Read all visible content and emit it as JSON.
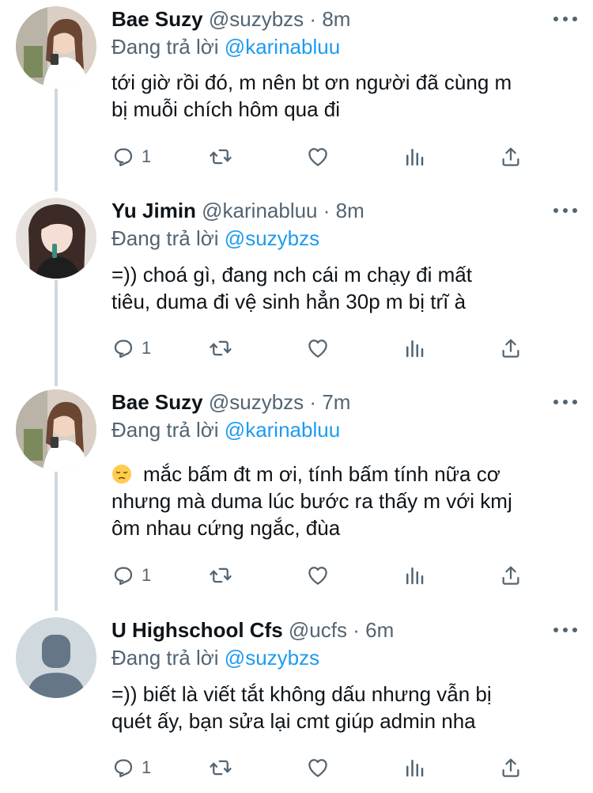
{
  "tweets": [
    {
      "name": "Bae Suzy",
      "handle": "@suzybzs",
      "dot": "·",
      "time": "8m",
      "reply_prefix": "Đang trả lời",
      "reply_to": "@karinabluu",
      "lines": [
        "tới giờ rồi đó, m nên bt ơn người đã cùng m",
        "bị muỗi chích hôm qua đi"
      ],
      "reply_count": "1",
      "avatar_icon": "user-photo"
    },
    {
      "name": "Yu Jimin",
      "handle": "@karinabluu",
      "dot": "·",
      "time": "8m",
      "reply_prefix": "Đang trả lời",
      "reply_to": "@suzybzs",
      "lines": [
        "=)) choá gì, đang nch cái m chạy đi mất",
        "tiêu, duma đi vệ sinh hẳn 30p m bị trĩ à"
      ],
      "reply_count": "1",
      "avatar_icon": "user-photo"
    },
    {
      "name": "Bae Suzy",
      "handle": "@suzybzs",
      "dot": "·",
      "time": "7m",
      "reply_prefix": "Đang trả lời",
      "reply_to": "@karinabluu",
      "emoji": "pensive-face-emoji",
      "lines": [
        "mắc bấm đt m ơi, tính bấm tính nữa cơ",
        "nhưng mà duma lúc bước ra thấy m với kmj",
        "ôm nhau cứng ngắc, đùa"
      ],
      "reply_count": "1",
      "avatar_icon": "user-photo"
    },
    {
      "name": "U Highschool Cfs",
      "handle": "@ucfs",
      "dot": "·",
      "time": "6m",
      "reply_prefix": "Đang trả lời",
      "reply_to": "@suzybzs",
      "lines": [
        "=)) biết là viết tắt không dấu nhưng vẫn bị",
        "quét ấy, bạn sửa lại cmt giúp admin nha"
      ],
      "reply_count": "1",
      "avatar_icon": "default-avatar"
    }
  ],
  "colors": {
    "text": "#0f1419",
    "muted": "#536471",
    "accent": "#1d9bf0",
    "line": "#cfd9de"
  },
  "action_icons": [
    "reply-icon",
    "retweet-icon",
    "like-icon",
    "views-icon",
    "share-icon"
  ]
}
